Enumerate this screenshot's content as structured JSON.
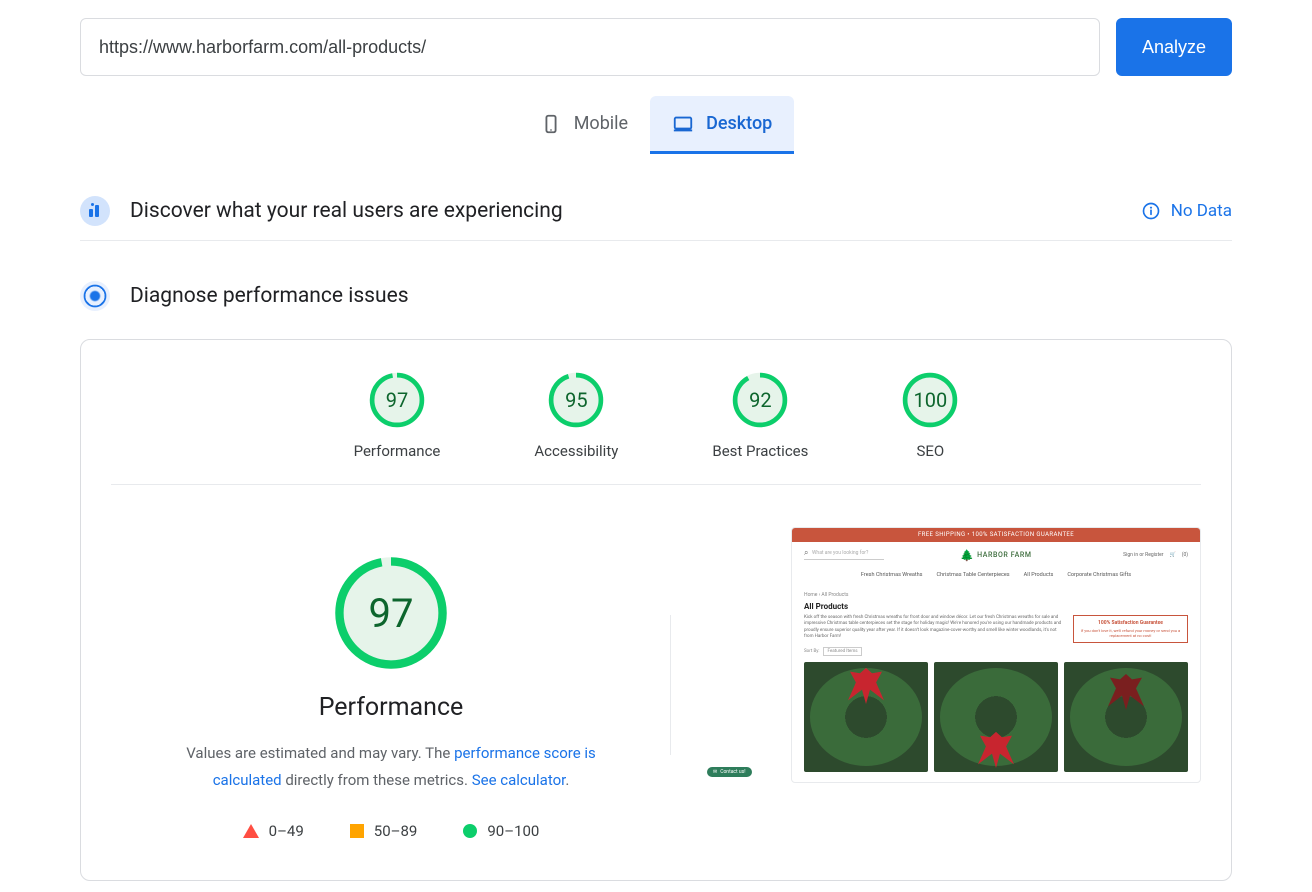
{
  "url_input": {
    "value": "https://www.harborfarm.com/all-products/",
    "placeholder": ""
  },
  "analyze_button": "Analyze",
  "tabs": {
    "mobile": "Mobile",
    "desktop": "Desktop",
    "active": "desktop"
  },
  "discover": {
    "title": "Discover what your real users are experiencing",
    "nodata_label": "No Data"
  },
  "diagnose": {
    "title": "Diagnose performance issues"
  },
  "gauges": [
    {
      "score": 97,
      "label": "Performance"
    },
    {
      "score": 95,
      "label": "Accessibility"
    },
    {
      "score": 92,
      "label": "Best Practices"
    },
    {
      "score": 100,
      "label": "SEO"
    }
  ],
  "detail": {
    "score": 97,
    "title": "Performance",
    "desc_prefix": "Values are estimated and may vary. The ",
    "link1": "performance score is calculated",
    "desc_mid": " directly from these metrics. ",
    "link2": "See calculator",
    "desc_suffix": "."
  },
  "legend": {
    "red": "0–49",
    "orange": "50–89",
    "green": "90–100"
  },
  "preview": {
    "banner": "FREE SHIPPING • 100% SATISFACTION GUARANTEE",
    "search_placeholder": "What are you looking for?",
    "brand": "HARBOR FARM",
    "signin": "Sign in or Register",
    "cart": "(0)",
    "nav": [
      "Fresh Christmas Wreaths",
      "Christmas Table Centerpieces",
      "All Products",
      "Corporate Christmas Gifts"
    ],
    "crumb": "Home › All Products",
    "heading": "All Products",
    "blurb": "Kick off the season with fresh Christmas wreaths for front door and window décor. Let our fresh Christmas wreaths for sale and impressive Christmas table centerpieces set the stage for holiday magic! We're honored you're using our handmade products and proudly ensure superior quality year after year. If it doesn't look magazine-cover-worthy and smell like winter woodlands, it's not from Harbor Farm!",
    "guarantee_title": "100% Satisfaction Guarantee",
    "guarantee_body": "If you don't love it, we'll refund your money or send you a replacement at no cost!",
    "sort_label": "Sort By:",
    "sort_value": "Featured Items",
    "chat": "Contact us!"
  },
  "colors": {
    "green": "#0cce6b",
    "green_dark": "#0d652d",
    "green_fill": "#e6f4ea",
    "blue": "#1a73e8"
  }
}
